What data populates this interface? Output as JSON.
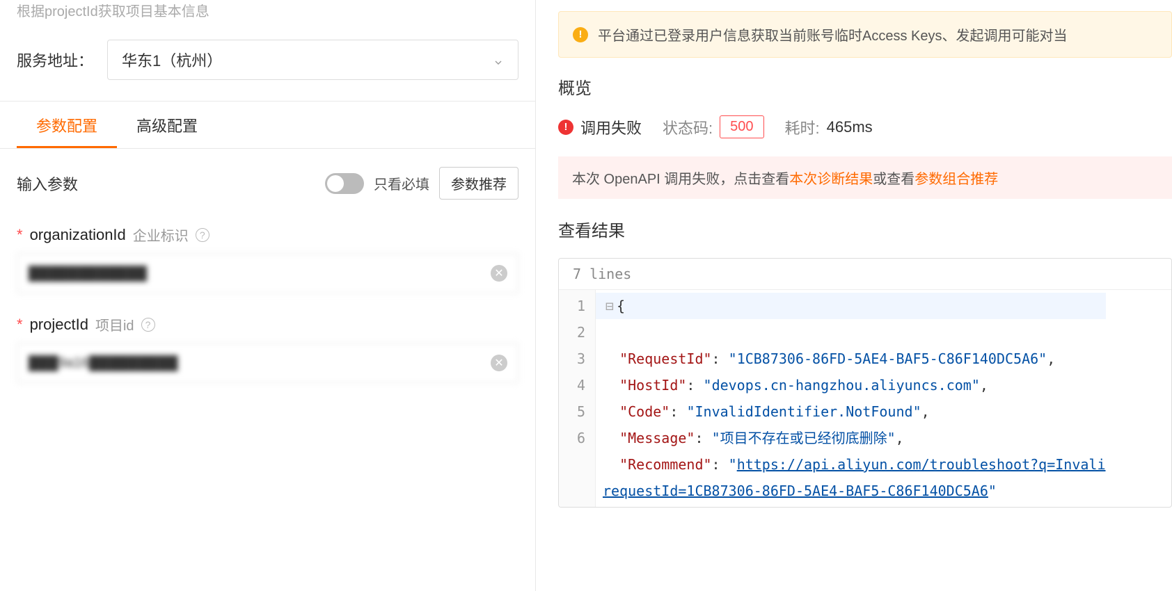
{
  "left": {
    "description": "根据projectId获取项目基本信息",
    "service_label": "服务地址：",
    "service_value": "华东1（杭州）",
    "tabs": {
      "params": "参数配置",
      "advanced": "高级配置"
    },
    "input_title": "输入参数",
    "toggle_label": "只看必填",
    "recommend_btn": "参数推荐",
    "fields": {
      "organizationId": {
        "name": "organizationId",
        "desc": "企业标识",
        "value": "████████████"
      },
      "projectId": {
        "name": "projectId",
        "desc": "项目id",
        "value": "███9a16█████████"
      }
    }
  },
  "right": {
    "notice": "平台通过已登录用户信息获取当前账号临时Access Keys、发起调用可能对当",
    "overview_title": "概览",
    "status": {
      "fail_text": "调用失败",
      "code_label": "状态码:",
      "code_value": "500",
      "elapsed_label": "耗时:",
      "elapsed_value": "465ms"
    },
    "err_banner": {
      "prefix": "本次 OpenAPI 调用失败，点击查看",
      "link1": "本次诊断结果",
      "mid": "或查看",
      "link2": "参数组合推荐"
    },
    "result_title": "查看结果",
    "code_header": "7 lines",
    "response": {
      "RequestId": "1CB87306-86FD-5AE4-BAF5-C86F140DC5A6",
      "HostId": "devops.cn-hangzhou.aliyuncs.com",
      "Code": "InvalidIdentifier.NotFound",
      "Message": "项目不存在或已经彻底删除",
      "Recommend_part1": "https://api.aliyun.com/troubleshoot?q=Invali",
      "Recommend_part2": "requestId=1CB87306-86FD-5AE4-BAF5-C86F140DC5A6"
    }
  }
}
